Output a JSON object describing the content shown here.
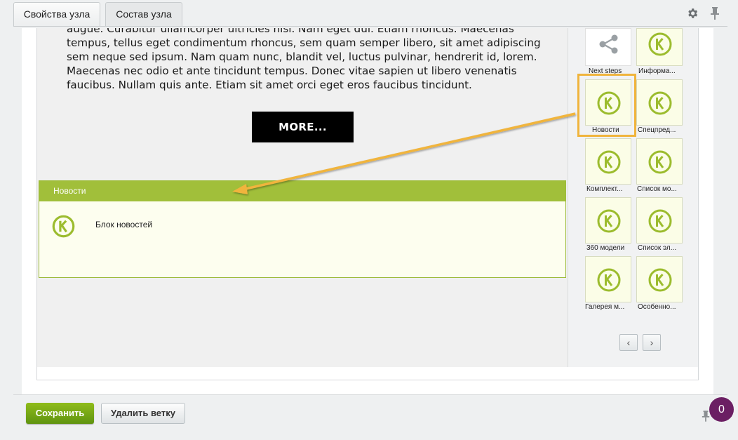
{
  "tabs": [
    {
      "label": "Свойства узла"
    },
    {
      "label": "Состав узла"
    }
  ],
  "header_icons": [
    "gear-icon",
    "pin-icon"
  ],
  "preview": {
    "text": "augue. Curabitur ullamcorper ultricies nisi. Nam eget dui. Etiam rhoncus. Maecenas tempus, tellus eget condimentum rhoncus, sem quam semper libero, sit amet adipiscing sem neque sed ipsum. Nam quam nunc, blandit vel, luctus pulvinar, hendrerit id, lorem. Maecenas nec odio et ante tincidunt tempus. Donec vitae sapien ut libero venenatis faucibus. Nullam quis ante. Etiam sit amet orci eget eros faucibus tincidunt.",
    "more_label": "MORE..."
  },
  "news_block": {
    "title": "Новости",
    "label": "Блок новостей",
    "icon": "k-logo-icon"
  },
  "palette": [
    {
      "label": "Next steps",
      "icon": "share-icon"
    },
    {
      "label": "Информа...",
      "icon": "k-logo-icon"
    },
    {
      "label": "Новости",
      "icon": "k-logo-icon",
      "selected": true
    },
    {
      "label": "Спецпред...",
      "icon": "k-logo-icon"
    },
    {
      "label": "Комплект...",
      "icon": "k-logo-icon"
    },
    {
      "label": "Список мо...",
      "icon": "k-logo-icon"
    },
    {
      "label": "360 модели",
      "icon": "k-logo-icon"
    },
    {
      "label": "Список эл...",
      "icon": "k-logo-icon"
    },
    {
      "label": "Галерея м...",
      "icon": "k-logo-icon"
    },
    {
      "label": "Особенно...",
      "icon": "k-logo-icon"
    }
  ],
  "pagination": {
    "prev": "‹",
    "next": "›"
  },
  "footer": {
    "save_label": "Сохранить",
    "delete_label": "Удалить ветку",
    "badge_count": "0"
  },
  "colors": {
    "accent_green": "#a1bf3a",
    "highlight": "#f0b43c",
    "badge": "#6b1f63"
  }
}
